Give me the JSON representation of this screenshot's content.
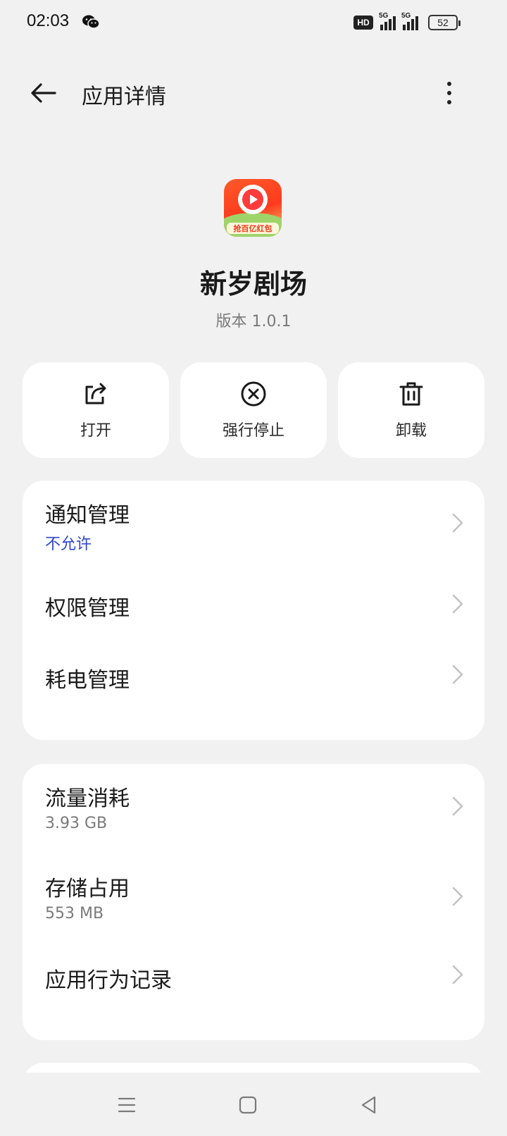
{
  "status_bar": {
    "time": "02:03",
    "hd_label": "HD",
    "signal_1_label": "5G",
    "signal_2_label": "5G",
    "battery": "52"
  },
  "header": {
    "title": "应用详情"
  },
  "app": {
    "icon_text": "抢百亿红包",
    "name": "新岁剧场",
    "version": "版本 1.0.1"
  },
  "actions": {
    "open_label": "打开",
    "force_stop_label": "强行停止",
    "uninstall_label": "卸载"
  },
  "settings_group_1": [
    {
      "title": "通知管理",
      "subtitle": "不允许"
    },
    {
      "title": "权限管理"
    },
    {
      "title": "耗电管理"
    }
  ],
  "settings_group_2": [
    {
      "title": "流量消耗",
      "subtitle": "3.93 GB"
    },
    {
      "title": "存储占用",
      "subtitle": "553 MB"
    },
    {
      "title": "应用行为记录"
    }
  ],
  "colors": {
    "background": "#f1f1f1",
    "card": "#ffffff",
    "accent_blue": "#2f47c9",
    "secondary_text": "#7a7a7a"
  },
  "icons": {
    "back": "arrow-left-icon",
    "more": "more-vertical-icon",
    "open": "share-open-icon",
    "force_stop": "close-circle-icon",
    "uninstall": "trash-icon",
    "chevron": "chevron-right-icon",
    "nav_menu": "menu-icon",
    "nav_home": "home-square-icon",
    "nav_back": "back-triangle-icon"
  }
}
